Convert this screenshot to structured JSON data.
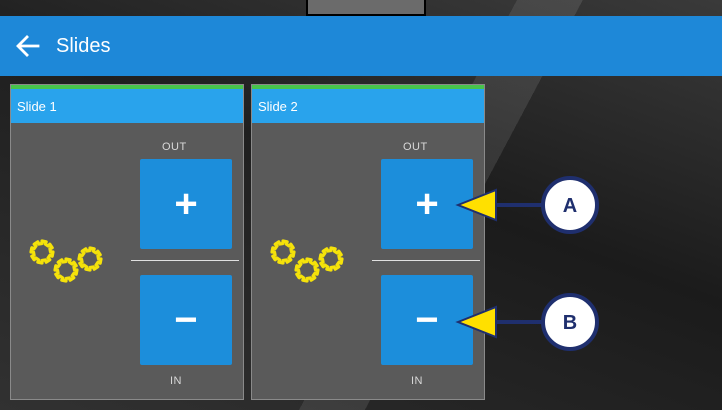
{
  "app": {
    "title": "Slides",
    "back_icon": "arrow-left-icon",
    "accent_color": "#1e88d8"
  },
  "slides": [
    {
      "title": "Slide 1",
      "out_label": "OUT",
      "in_label": "IN",
      "plus_label": "+",
      "minus_label": "−",
      "status_icon": "gears-icon"
    },
    {
      "title": "Slide 2",
      "out_label": "OUT",
      "in_label": "IN",
      "plus_label": "+",
      "minus_label": "−",
      "status_icon": "gears-icon"
    }
  ],
  "callouts": [
    {
      "label": "A",
      "target": "slide-2-out-button"
    },
    {
      "label": "B",
      "target": "slide-2-in-button"
    }
  ]
}
